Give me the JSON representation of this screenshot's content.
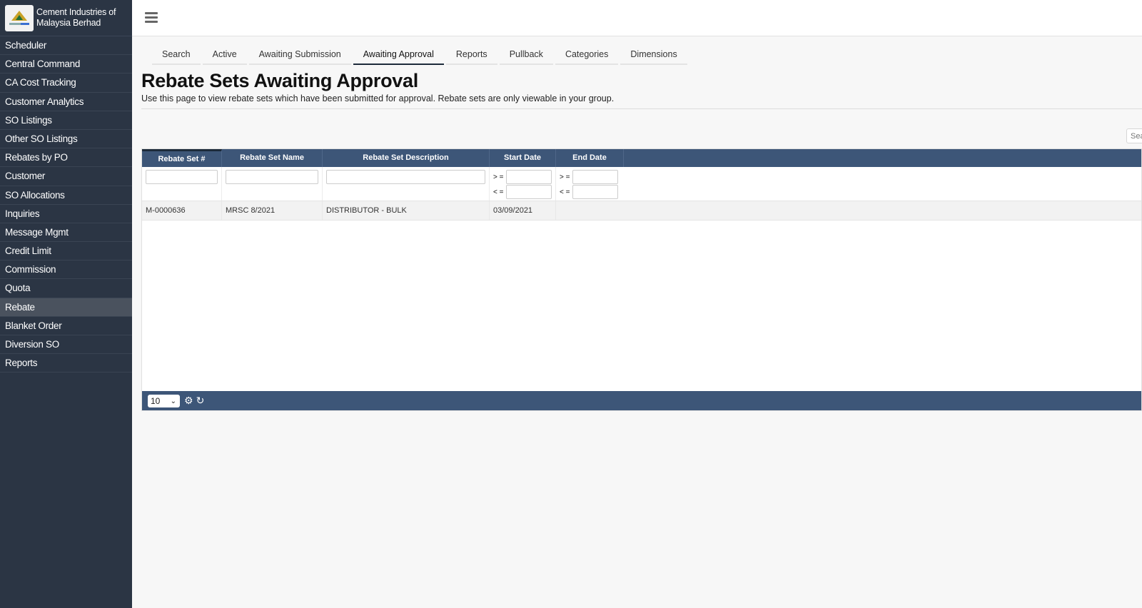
{
  "brand": {
    "name_line1": "Cement Industries of",
    "name_line2": "Malaysia Berhad"
  },
  "sidebar": {
    "items": [
      {
        "label": "Scheduler"
      },
      {
        "label": "Central Command"
      },
      {
        "label": "CA Cost Tracking"
      },
      {
        "label": "Customer Analytics"
      },
      {
        "label": "SO Listings"
      },
      {
        "label": "Other SO Listings"
      },
      {
        "label": "Rebates by PO"
      },
      {
        "label": "Customer"
      },
      {
        "label": "SO Allocations"
      },
      {
        "label": "Inquiries"
      },
      {
        "label": "Message Mgmt"
      },
      {
        "label": "Credit Limit"
      },
      {
        "label": "Commission"
      },
      {
        "label": "Quota"
      },
      {
        "label": "Rebate",
        "active": true
      },
      {
        "label": "Blanket Order"
      },
      {
        "label": "Diversion SO"
      },
      {
        "label": "Reports"
      }
    ]
  },
  "tabs": [
    {
      "label": "Search"
    },
    {
      "label": "Active"
    },
    {
      "label": "Awaiting Submission"
    },
    {
      "label": "Awaiting Approval",
      "active": true
    },
    {
      "label": "Reports"
    },
    {
      "label": "Pullback"
    },
    {
      "label": "Categories"
    },
    {
      "label": "Dimensions"
    }
  ],
  "page": {
    "title": "Rebate Sets Awaiting Approval",
    "description": "Use this page to view rebate sets which have been submitted for approval. Rebate sets are only viewable in your group.",
    "search_placeholder": "Search"
  },
  "grid": {
    "columns": [
      "Rebate Set #",
      "Rebate Set Name",
      "Rebate Set Description",
      "Start Date",
      "End Date"
    ],
    "filter_ops": {
      "gte": "> =",
      "lte": "< ="
    },
    "rows": [
      {
        "rebate_set": "M-0000636",
        "name": "MRSC 8/2021",
        "description": "DISTRIBUTOR - BULK",
        "start_date": "03/09/2021",
        "end_date": ""
      }
    ],
    "page_size": "10"
  },
  "colors": {
    "sidebar_bg": "#2b3544",
    "grid_header": "#3d5678",
    "active_nav": "#4a525e"
  }
}
